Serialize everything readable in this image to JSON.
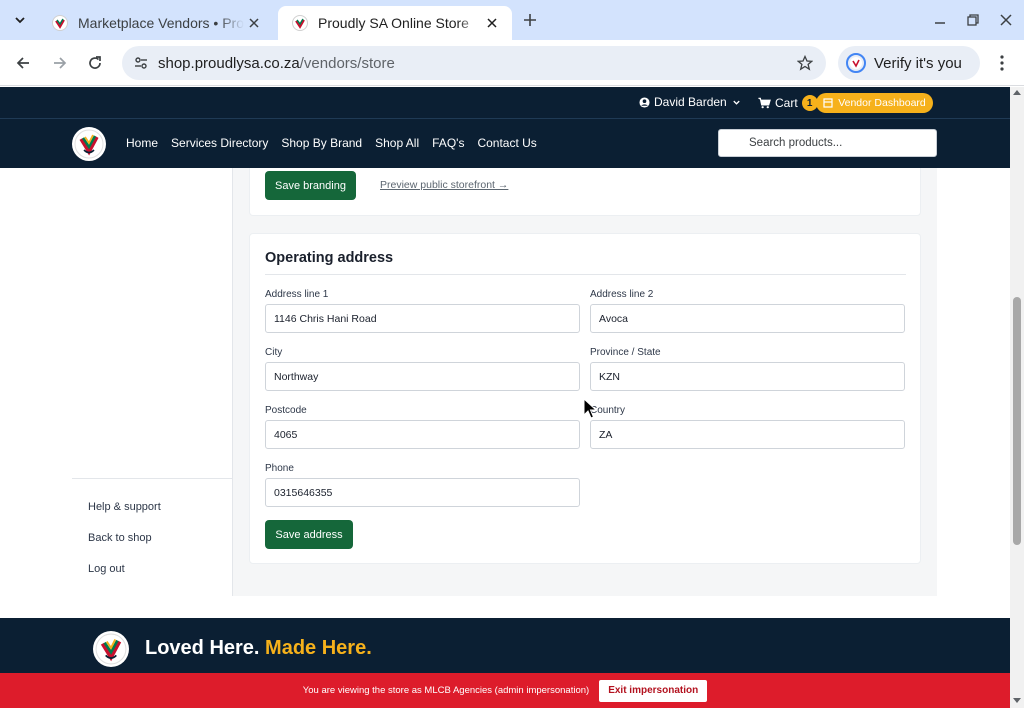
{
  "browser": {
    "tabs": [
      {
        "title": "Marketplace Vendors • Proudly SA",
        "active": false
      },
      {
        "title": "Proudly SA Online Store",
        "active": true
      }
    ],
    "url_host": "shop.proudlysa.co.za",
    "url_path": "/vendors/store",
    "verify_label": "Verify it's you"
  },
  "header": {
    "user_name": "David Barden",
    "cart_label": "Cart",
    "cart_count": "1",
    "vendor_dashboard_label": "Vendor Dashboard"
  },
  "nav": {
    "items": [
      "Home",
      "Services Directory",
      "Shop By Brand",
      "Shop All",
      "FAQ's",
      "Contact Us"
    ],
    "search_placeholder": "Search products..."
  },
  "branding": {
    "save_label": "Save branding",
    "preview_label": "Preview public storefront →"
  },
  "address": {
    "title": "Operating address",
    "fields": {
      "address_line_1": {
        "label": "Address line 1",
        "value": "1146 Chris Hani Road"
      },
      "address_line_2": {
        "label": "Address line 2",
        "value": "Avoca"
      },
      "city": {
        "label": "City",
        "value": "Northway"
      },
      "province": {
        "label": "Province / State",
        "value": "KZN"
      },
      "postcode": {
        "label": "Postcode",
        "value": "4065"
      },
      "country": {
        "label": "Country",
        "value": "ZA"
      },
      "phone": {
        "label": "Phone",
        "value": "0315646355"
      }
    },
    "save_label": "Save address"
  },
  "sidebar": {
    "links": [
      "Help & support",
      "Back to shop",
      "Log out"
    ]
  },
  "footer": {
    "tagline_start": "Loved Here.",
    "tagline_accent": "Made Here."
  },
  "impersonation": {
    "message": "You are viewing the store as MLCB Agencies (admin impersonation)",
    "exit_label": "Exit impersonation"
  },
  "colors": {
    "navy": "#0b1f33",
    "brand_green": "#15673a",
    "gold": "#f6b11b",
    "alert_red": "#dd1c2b"
  }
}
